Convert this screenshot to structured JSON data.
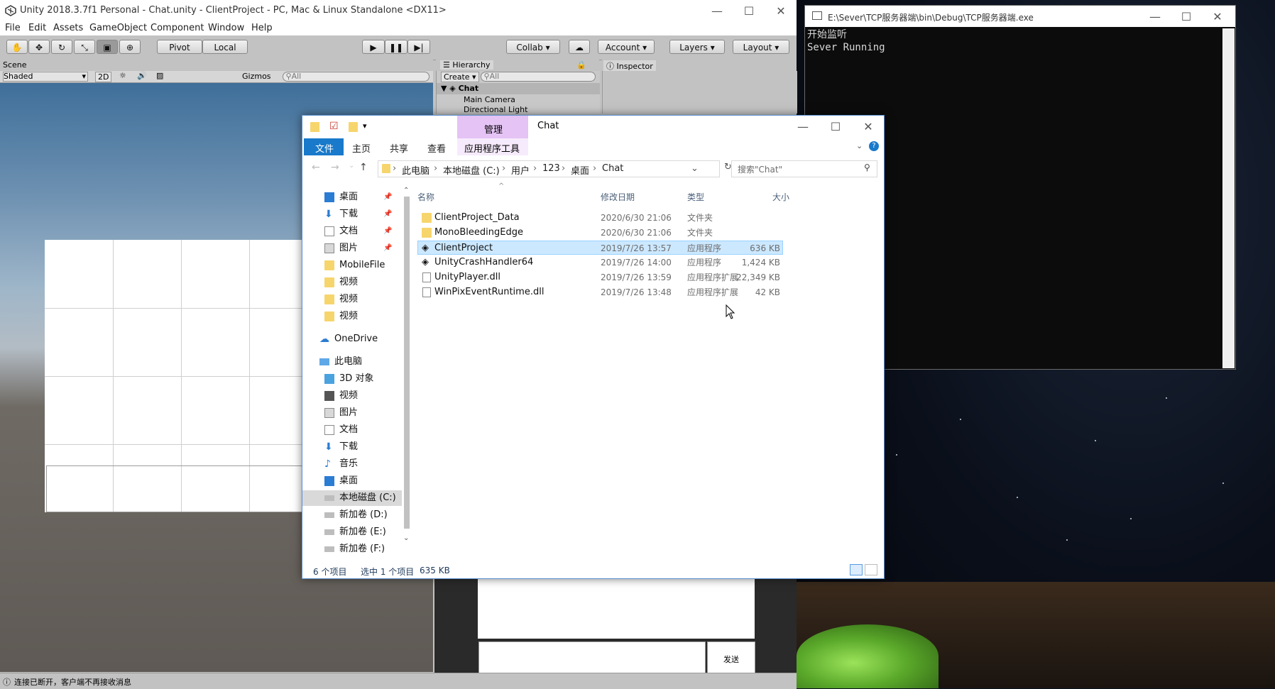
{
  "unity": {
    "title": "Unity 2018.3.7f1 Personal - Chat.unity - ClientProject - PC, Mac & Linux Standalone <DX11>",
    "menu": [
      "File",
      "Edit",
      "Assets",
      "GameObject",
      "Component",
      "Window",
      "Help"
    ],
    "toolbar": {
      "pivot": "Pivot",
      "local": "Local",
      "collab": "Collab",
      "account": "Account",
      "layers": "Layers",
      "layout": "Layout"
    },
    "scene": {
      "tab": "Scene",
      "shading": "Shaded",
      "two_d": "2D",
      "gizmos": "Gizmos",
      "search": "All"
    },
    "hierarchy": {
      "tab": "Hierarchy",
      "create": "Create",
      "search": "All",
      "root": "Chat",
      "items": [
        "Main Camera",
        "Directional Light"
      ]
    },
    "inspector": {
      "tab": "Inspector"
    },
    "game": {
      "send_button": "发送"
    },
    "status": "连接已断开，客户端不再接收消息"
  },
  "console": {
    "title": "E:\\Sever\\TCP服务器端\\bin\\Debug\\TCP服务器端.exe",
    "lines": [
      "开始监听",
      "Sever Running"
    ]
  },
  "explorer": {
    "title": "Chat",
    "manage_tab": "管理",
    "ribbon_tabs": [
      "文件",
      "主页",
      "共享",
      "查看",
      "应用程序工具"
    ],
    "breadcrumb": [
      "此电脑",
      "本地磁盘 (C:)",
      "用户",
      "123",
      "桌面",
      "Chat"
    ],
    "search_placeholder": "搜索\"Chat\"",
    "columns": {
      "name": "名称",
      "date": "修改日期",
      "type": "类型",
      "size": "大小"
    },
    "nav": {
      "quick": [
        "桌面",
        "下载",
        "文档",
        "图片",
        "MobileFile",
        "视频",
        "视频",
        "视频"
      ],
      "onedrive": "OneDrive",
      "this_pc": "此电脑",
      "pc_items": [
        "3D 对象",
        "视频",
        "图片",
        "文档",
        "下载",
        "音乐",
        "桌面",
        "本地磁盘 (C:)",
        "新加卷 (D:)",
        "新加卷 (E:)",
        "新加卷 (F:)"
      ]
    },
    "files": [
      {
        "name": "ClientProject_Data",
        "date": "2020/6/30 21:06",
        "type": "文件夹",
        "size": "",
        "icon": "folder-icon"
      },
      {
        "name": "MonoBleedingEdge",
        "date": "2020/6/30 21:06",
        "type": "文件夹",
        "size": "",
        "icon": "folder-icon"
      },
      {
        "name": "ClientProject",
        "date": "2019/7/26 13:57",
        "type": "应用程序",
        "size": "636 KB",
        "icon": "unity-app-icon"
      },
      {
        "name": "UnityCrashHandler64",
        "date": "2019/7/26 14:00",
        "type": "应用程序",
        "size": "1,424 KB",
        "icon": "unity-app-icon"
      },
      {
        "name": "UnityPlayer.dll",
        "date": "2019/7/26 13:59",
        "type": "应用程序扩展",
        "size": "22,349 KB",
        "icon": "dll-icon"
      },
      {
        "name": "WinPixEventRuntime.dll",
        "date": "2019/7/26 13:48",
        "type": "应用程序扩展",
        "size": "42 KB",
        "icon": "dll-icon"
      }
    ],
    "status": {
      "count": "6 个项目",
      "selected": "选中 1 个项目",
      "size": "635 KB"
    },
    "colors": {
      "accent": "#1979ca",
      "selection": "#cce8ff",
      "manage": "#e5c3f5"
    }
  }
}
